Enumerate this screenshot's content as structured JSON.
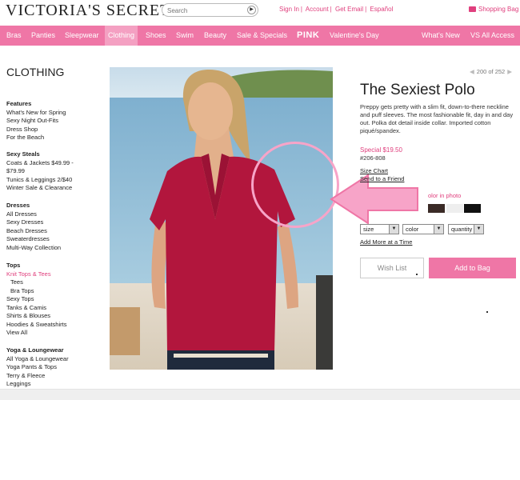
{
  "header": {
    "logo": "VICTORIA'S SECRET",
    "search_placeholder": "Search",
    "top_links": [
      "Sign In",
      "Account",
      "Get Email",
      "Español"
    ],
    "shopping_bag": "Shopping Bag"
  },
  "nav": {
    "items": [
      "Bras",
      "Panties",
      "Sleepwear",
      "Clothing",
      "Shoes",
      "Swim",
      "Beauty",
      "Sale & Specials",
      "PINK",
      "Valentine's Day",
      "What's New",
      "VS All Access"
    ],
    "active": "Clothing"
  },
  "sidebar": {
    "title": "CLOTHING",
    "groups": [
      {
        "head": "Features",
        "items": [
          "What's New for Spring",
          "Sexy Night Out-Fits",
          "Dress Shop",
          "For the Beach"
        ]
      },
      {
        "head": "Sexy Steals",
        "items": [
          "Coats & Jackets $49.99 -",
          "$79.99",
          "Tunics & Leggings 2/$40",
          "Winter Sale & Clearance"
        ]
      },
      {
        "head": "Dresses",
        "items": [
          "All Dresses",
          "Sexy Dresses",
          "Beach Dresses",
          "Sweaterdresses",
          "Multi-Way Collection"
        ]
      },
      {
        "head": "Tops",
        "selected": "Knit Tops & Tees",
        "sub": [
          "Tees",
          "Bra Tops"
        ],
        "items": [
          "Sexy Tops",
          "Tanks & Camis",
          "Shirts & Blouses",
          "Hoodies & Sweatshirts",
          "View All"
        ]
      },
      {
        "head": "Yoga & Loungewear",
        "items": [
          "All Yoga & Loungewear",
          "Yoga Pants & Tops",
          "Terry & Fleece",
          "Leggings"
        ]
      }
    ]
  },
  "product": {
    "pager": "200 of 252",
    "title": "The Sexiest Polo",
    "description": "Preppy gets pretty with a slim fit, down-to-there neckline and puff sleeves. The most fashionable fit, day in and day out. Polka dot detail inside collar. Imported cotton piqué/spandex.",
    "price": "Special $19.50",
    "sku": "#206-808",
    "size_chart": "Size Chart",
    "send_friend": "Send to a Friend",
    "color_in_photo": "olor in photo",
    "swatches": [
      "#3a2a26",
      "#eeeeee",
      "#111111"
    ],
    "selects": [
      "size",
      "color",
      "quantity"
    ],
    "add_more": "Add More at a Time",
    "wish_list": "Wish List",
    "add_to_bag": "Add to Bag"
  },
  "colors": {
    "brand_pink": "#ef76a6",
    "link_pink": "#e0407e",
    "annotation": "#f7a4c8"
  }
}
